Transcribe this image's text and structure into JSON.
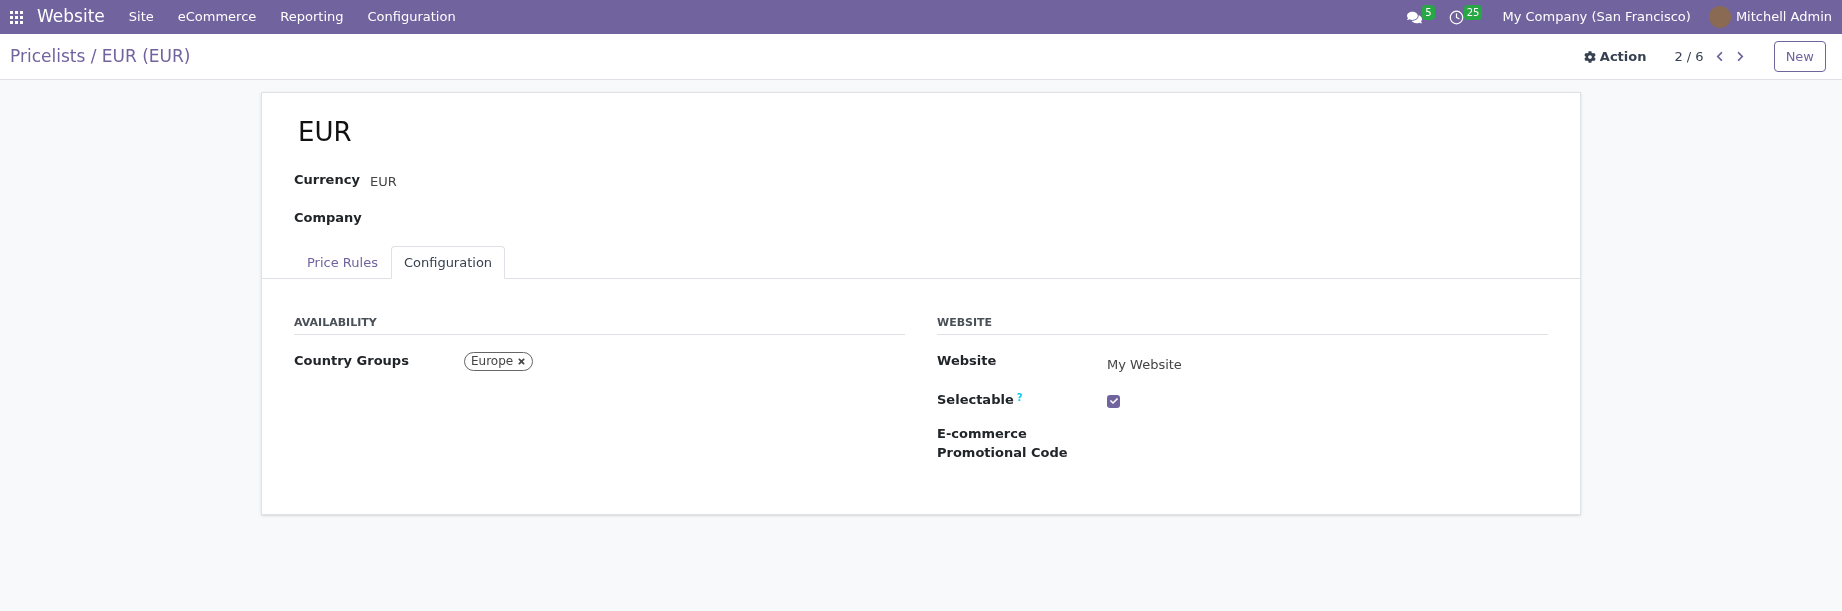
{
  "navbar": {
    "app_name": "Website",
    "menu": [
      "Site",
      "eCommerce",
      "Reporting",
      "Configuration"
    ],
    "messages_count": "5",
    "activities_count": "25",
    "company": "My Company (San Francisco)",
    "user": "Mitchell Admin"
  },
  "control_panel": {
    "breadcrumb": "Pricelists / EUR (EUR)",
    "action": "Action",
    "pager": "2 / 6",
    "new_button": "New"
  },
  "record": {
    "title": "EUR",
    "fields": [
      {
        "label": "Currency",
        "value": "EUR"
      },
      {
        "label": "Company"
      }
    ]
  },
  "tabs": [
    {
      "label": "Price Rules",
      "selected": false
    },
    {
      "label": "Configuration",
      "selected": true
    }
  ],
  "groups": [
    {
      "title": "AVAILABILITY",
      "fields": [
        {
          "kind": "tags",
          "label": "Country Groups",
          "tags": [
            "Europe"
          ]
        }
      ]
    },
    {
      "title": "WEBSITE",
      "fields": [
        {
          "kind": "text",
          "label": "Website",
          "value": "My Website"
        },
        {
          "kind": "checkbox",
          "label": "Selectable",
          "help": "?",
          "checked": true
        },
        {
          "kind": "text",
          "label": "E-commerce Promotional Code"
        }
      ]
    }
  ]
}
